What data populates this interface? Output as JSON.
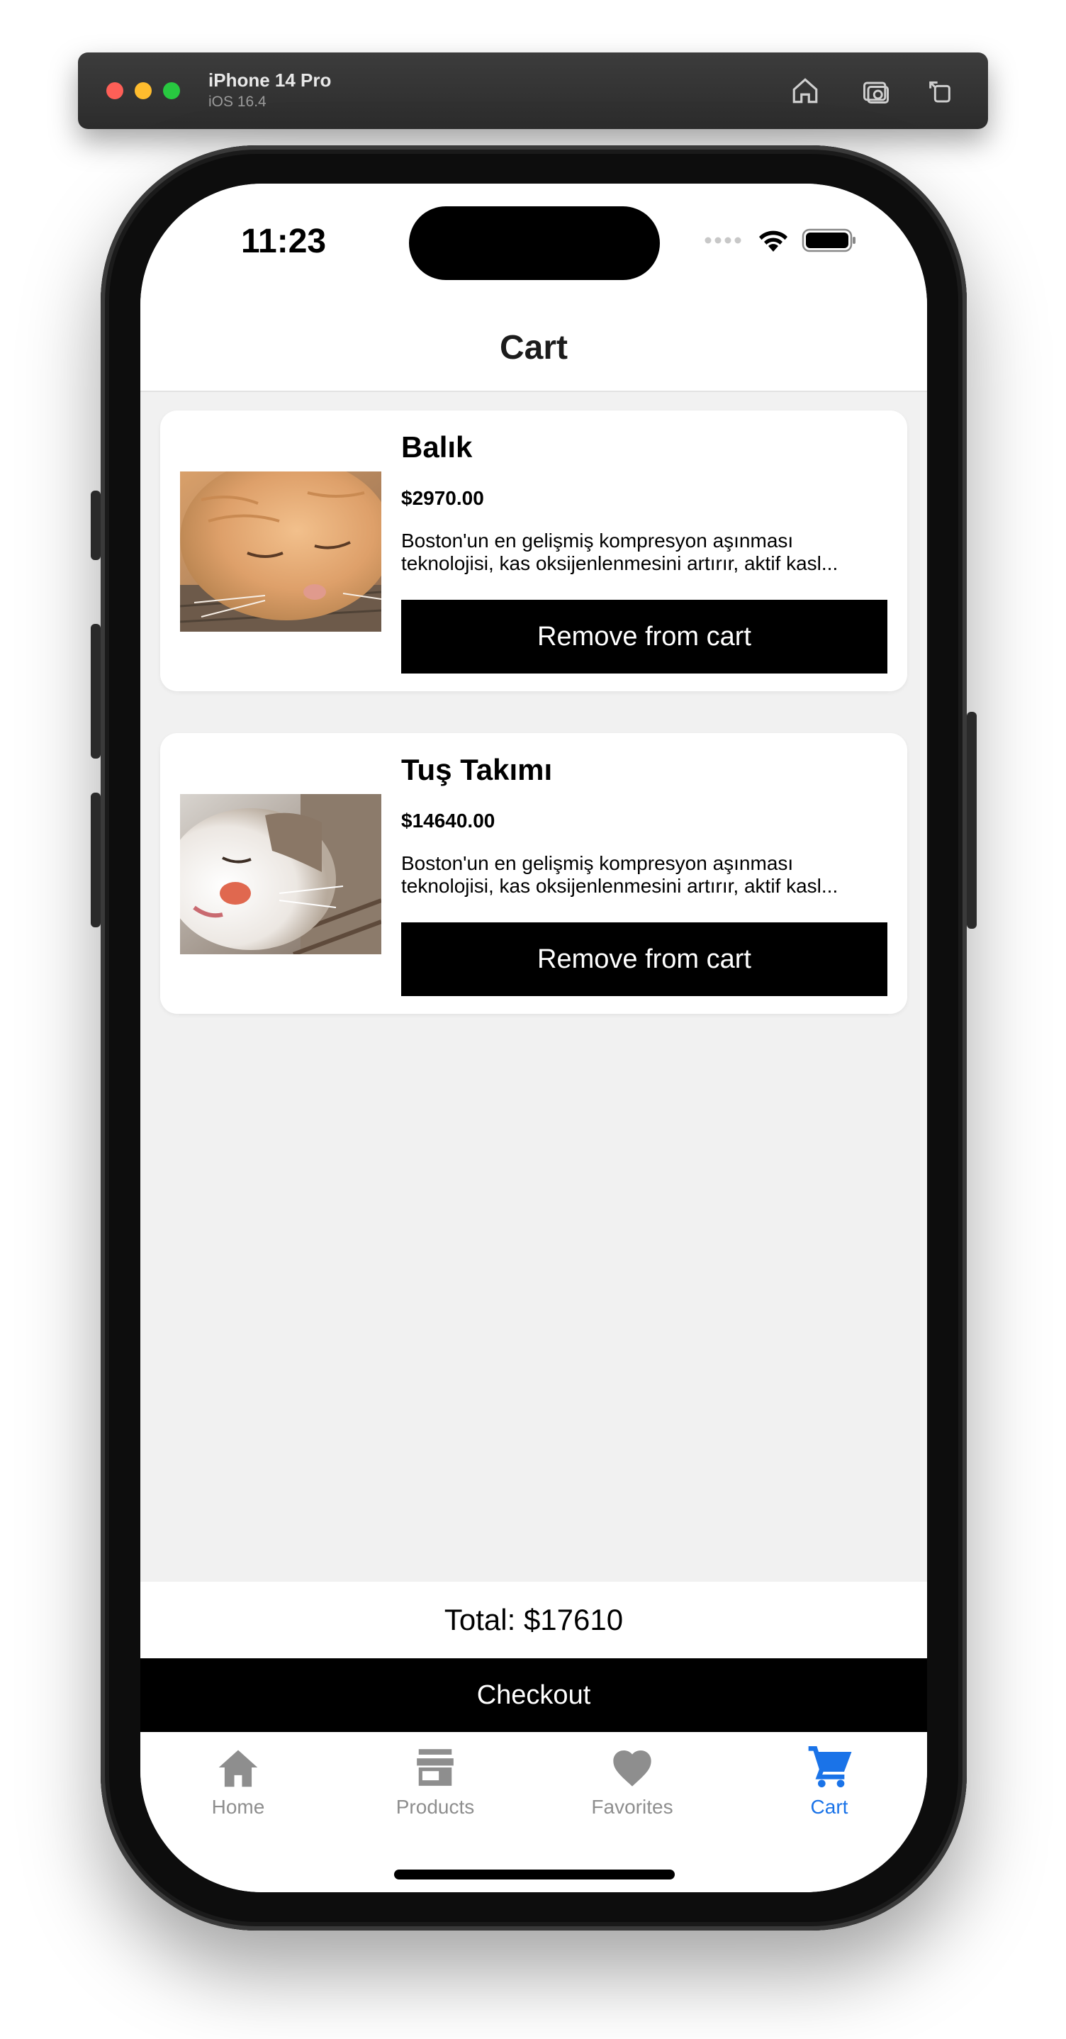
{
  "simulator": {
    "device": "iPhone 14 Pro",
    "os": "iOS 16.4",
    "icons": [
      "home-icon",
      "screenshot-icon",
      "rotate-icon"
    ]
  },
  "status_bar": {
    "time": "11:23"
  },
  "nav": {
    "title": "Cart"
  },
  "cart_items": [
    {
      "name": "Balık",
      "price": "$2970.00",
      "description": "Boston'un en gelişmiş kompresyon aşınması teknolojisi, kas oksijenlenmesini artırır, aktif kasl...",
      "button": "Remove from cart",
      "image": "orange-cat-sleeping"
    },
    {
      "name": "Tuş Takımı",
      "price": "$14640.00",
      "description": "Boston'un en gelişmiş kompresyon aşınması teknolojisi, kas oksijenlenmesini artırır, aktif kasl...",
      "button": "Remove from cart",
      "image": "white-cat-sleeping"
    }
  ],
  "summary": {
    "total": "Total: $17610",
    "checkout": "Checkout"
  },
  "tabs": [
    {
      "label": "Home",
      "icon": "home-icon"
    },
    {
      "label": "Products",
      "icon": "store-icon"
    },
    {
      "label": "Favorites",
      "icon": "heart-icon"
    },
    {
      "label": "Cart",
      "icon": "cart-icon",
      "active": true
    }
  ],
  "colors": {
    "accent": "#1a73e8",
    "inactive": "#8e8e8e",
    "button": "#000000",
    "background": "#f1f1f1"
  }
}
